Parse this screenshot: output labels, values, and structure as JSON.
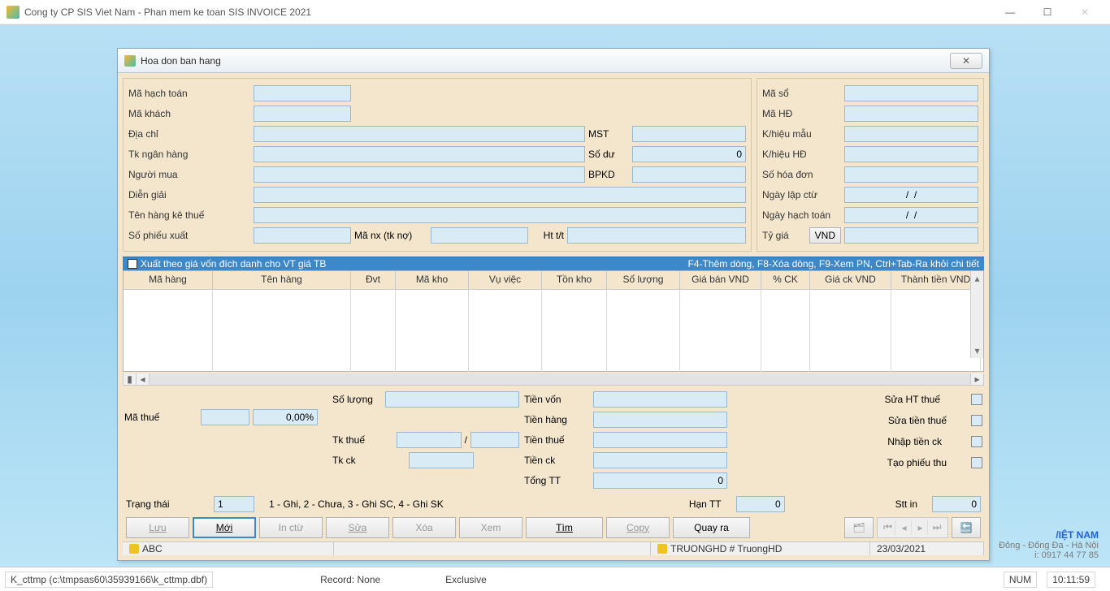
{
  "titlebar": {
    "title": "Cong ty CP SIS Viet Nam - Phan mem ke toan SIS INVOICE 2021"
  },
  "bg": {
    "line1": "/IỆT NAM",
    "line2": "Đông - Đống Đa - Hà Nội",
    "line3": "i: 0917 44 77 85"
  },
  "dialog": {
    "title": "Hoa don ban hang",
    "left": {
      "ma_hach_toan": "Mã hạch toán",
      "ma_khach": "Mã khách",
      "dia_chi": "Địa chỉ",
      "mst": "MST",
      "tk_ngan_hang": "Tk ngân hàng",
      "so_du": "Số dư",
      "so_du_val": "0",
      "nguoi_mua": "Người mua",
      "bpkd": "BPKD",
      "dien_giai": "Diễn giải",
      "ten_hang_ke_thue": "Tên hàng kê thuế",
      "so_phieu_xuat": "Số phiếu xuất",
      "ma_nx": "Mã nx (tk nợ)",
      "ht_tt": "Ht t/t"
    },
    "right": {
      "ma_so": "Mã sổ",
      "ma_hd": "Mã HĐ",
      "khieu_mau": "K/hiệu mẫu",
      "khieu_hd": "K/hiệu HĐ",
      "so_hoa_don": "Số hóa đơn",
      "ngay_lap_ctu": "Ngày lập ctừ",
      "ngay_hach_toan": "Ngày hạch toán",
      "date_placeholder": "/  /",
      "ty_gia": "Tỷ giá",
      "currency": "VND"
    },
    "bluebar": {
      "checkbox_label": "Xuất theo giá vốn đích danh cho VT giá TB",
      "hints": "F4-Thêm dòng, F8-Xóa dòng, F9-Xem PN, Ctrl+Tab-Ra khỏi chi tiết"
    },
    "grid": {
      "cols": [
        "Mã hàng",
        "Tên hàng",
        "Đvt",
        "Mã kho",
        "Vụ việc",
        "Tồn kho",
        "Số lượng",
        "Giá bán VND",
        "% CK",
        "Giá ck VND",
        "Thành tiền VND"
      ],
      "widths": [
        110,
        170,
        55,
        90,
        90,
        80,
        90,
        100,
        60,
        100,
        110
      ]
    },
    "summary": {
      "so_luong": "Số lượng",
      "ma_thue": "Mã thuế",
      "ma_thue_pct": "0,00%",
      "tk_thue": "Tk thuế",
      "tk_ck": "Tk ck",
      "tien_von": "Tiền vốn",
      "tien_hang": "Tiền hàng",
      "tien_thue": "Tiền thuế",
      "tien_ck": "Tiền ck",
      "tong_tt": "Tổng TT",
      "tong_tt_val": "0",
      "sua_ht_thue": "Sửa HT thuế",
      "sua_tien_thue": "Sửa tiền thuế",
      "nhap_tien_ck": "Nhập tiền ck",
      "tao_phieu_thu": "Tạo phiếu thu"
    },
    "state": {
      "trang_thai": "Trạng thái",
      "trang_thai_val": "1",
      "trang_thai_desc": "1 - Ghi, 2 - Chưa, 3 - Ghi SC, 4 - Ghi SK",
      "han_tt": "Hạn TT",
      "han_tt_val": "0",
      "stt_in": "Stt in",
      "stt_in_val": "0"
    },
    "buttons": {
      "luu": "Lưu",
      "moi": "Mới",
      "in_ctu": "In ctừ",
      "sua": "Sửa",
      "xoa": "Xóa",
      "xem": "Xem",
      "tim": "Tìm",
      "copy": "Copy",
      "quay_ra": "Quay ra"
    },
    "status": {
      "abc": "ABC",
      "user": "TRUONGHD # TruongHD",
      "date": "23/03/2021"
    }
  },
  "appstatus": {
    "path": "K_cttmp (c:\\tmpsas60\\35939166\\k_cttmp.dbf)",
    "record": "Record: None",
    "mode": "Exclusive",
    "num": "NUM",
    "time": "10:11:59"
  }
}
